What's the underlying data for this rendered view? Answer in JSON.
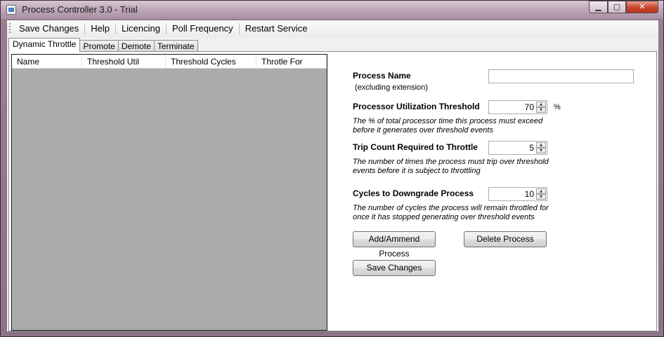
{
  "window": {
    "title": "Process Controller 3.0 - Trial",
    "controls": {
      "minimize": "▁",
      "maximize": "▢",
      "close": "✕"
    }
  },
  "menu": {
    "items": [
      "Save Changes",
      "Help",
      "Licencing",
      "Poll Frequency",
      "Restart Service"
    ]
  },
  "tabs": [
    "Dynamic Throttle",
    "Promote",
    "Demote",
    "Terminate"
  ],
  "list": {
    "columns": [
      "Name",
      "Threshold Util",
      "Threshold Cycles",
      "Throtle For"
    ]
  },
  "form": {
    "process_name": {
      "label": "Process Name",
      "sublabel": "(excluding extension)",
      "value": ""
    },
    "cpu_threshold": {
      "label": "Processor Utilization Threshold",
      "value": "70",
      "unit": "%",
      "desc": "The % of total processor time this process must exceed before it generates over threshold events"
    },
    "trip_count": {
      "label": "Trip Count Required to Throttle",
      "value": "5",
      "desc": "The number of times the process must trip over threshold events before it is subject to throttling"
    },
    "cycles": {
      "label": "Cycles to Downgrade Process",
      "value": "10",
      "desc": "The number of cycles the process will remain throttled for once it has stopped generating over threshold events"
    },
    "buttons": {
      "add": "Add/Ammend Process",
      "delete": "Delete Process",
      "save": "Save Changes"
    }
  }
}
